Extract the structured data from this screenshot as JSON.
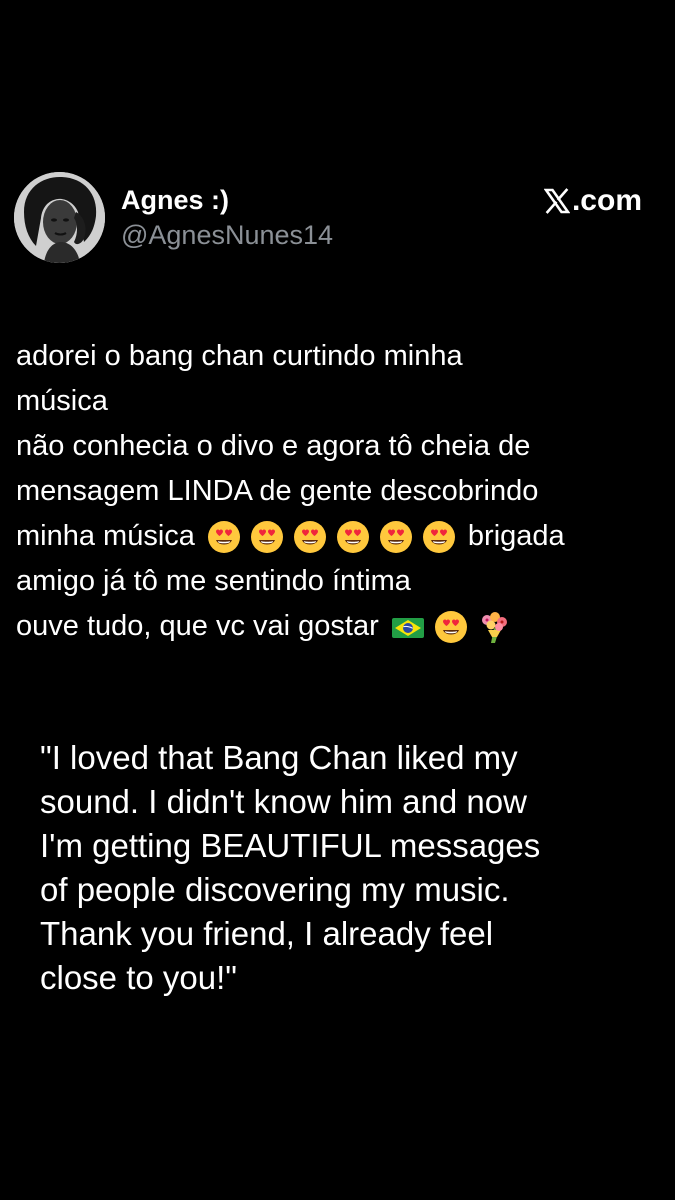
{
  "author": {
    "display_name": "Agnes :)",
    "handle": "@AgnesNunes14",
    "avatar_icon": "profile-photo"
  },
  "brand": {
    "text": ".com",
    "icon": "x-logo-icon"
  },
  "tweet": {
    "lines": [
      "adorei o bang chan curtindo minha",
      "música",
      "não conhecia o divo e agora tô cheia de",
      "mensagem LINDA de gente descobrindo",
      "minha música",
      "amigo já tô me sentindo íntima",
      "ouve tudo, que vc vai gostar"
    ],
    "line5_after_emojis": "brigada",
    "emojis_line5": [
      "heart-eyes",
      "heart-eyes",
      "heart-eyes",
      "heart-eyes",
      "heart-eyes",
      "heart-eyes"
    ],
    "emojis_line7": [
      "brazil-flag",
      "heart-eyes",
      "bouquet"
    ]
  },
  "translation": {
    "lines": [
      "\"I loved that Bang Chan liked my",
      "sound. I didn't know him and now",
      "I'm getting BEAUTIFUL messages",
      "of people discovering my music.",
      "Thank you friend, I already feel",
      "close to you!\""
    ]
  },
  "colors": {
    "background": "#000000",
    "text": "#ffffff",
    "handle": "#8b9096",
    "emoji_face": "#ffc83d",
    "emoji_heart": "#f0263c",
    "flag_green": "#229e45",
    "flag_yellow": "#f8e509"
  }
}
